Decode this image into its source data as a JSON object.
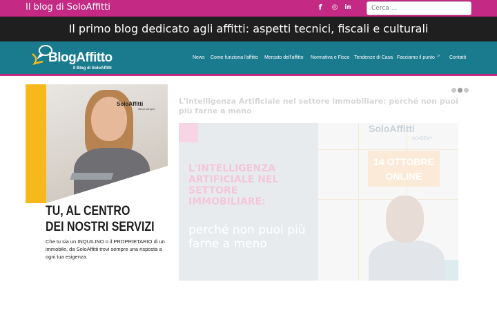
{
  "topbar": {
    "site_name": "Il blog di SoloAffitti",
    "social": [
      {
        "icon": "facebook-icon",
        "glyph": "f"
      },
      {
        "icon": "instagram-icon",
        "glyph": "◎"
      },
      {
        "icon": "linkedin-icon",
        "glyph": "in"
      }
    ],
    "search_placeholder": "Cerca ..."
  },
  "tagline": "Il primo blog dedicato agli affitti: aspetti tecnici, fiscali e culturali",
  "logo": {
    "text": "BlogAffitto",
    "sub": "Il Blog di SoloAffitti"
  },
  "nav": {
    "items": [
      "News",
      "Come funziona l'affitto",
      "Mercato dell'affitto",
      "Normativa e Fisco",
      "Tendenze di Casa",
      "Facciamo il punto",
      "Contatti"
    ],
    "separator": ">"
  },
  "ad": {
    "brand": "SoloAffitti",
    "brand_sub": "Sicuri sempre",
    "headline_1": "TU, AL CENTRO",
    "headline_2": "DEI NOSTRI SERVIZI",
    "body": "Che tu sia un INQUILINO o il PROPRIETARIO di un immobile, da SoloAffitti trovi sempre una risposta a ogni tua esigenza."
  },
  "slider": {
    "active_index": 1,
    "count": 3,
    "title": "L'intelligenza Artificiale nel settore immobiliare: perché non puoi più farne a meno",
    "image": {
      "headline": "L'INTELLIGENZA ARTIFICIALE NEL SETTORE IMMOBILIARE:",
      "sub": "perché non puoi più farne a meno",
      "academy": "SoloAffitti",
      "academy_sub": "ACADEMY",
      "date_line_1": "14 OTTOBRE",
      "date_line_2": "ONLINE"
    }
  },
  "colors": {
    "topbar": "#c42a84",
    "tagline_bg": "#1f1f1f",
    "nav_bg": "#1b7b8e",
    "accent_yellow": "#f6b81b"
  }
}
